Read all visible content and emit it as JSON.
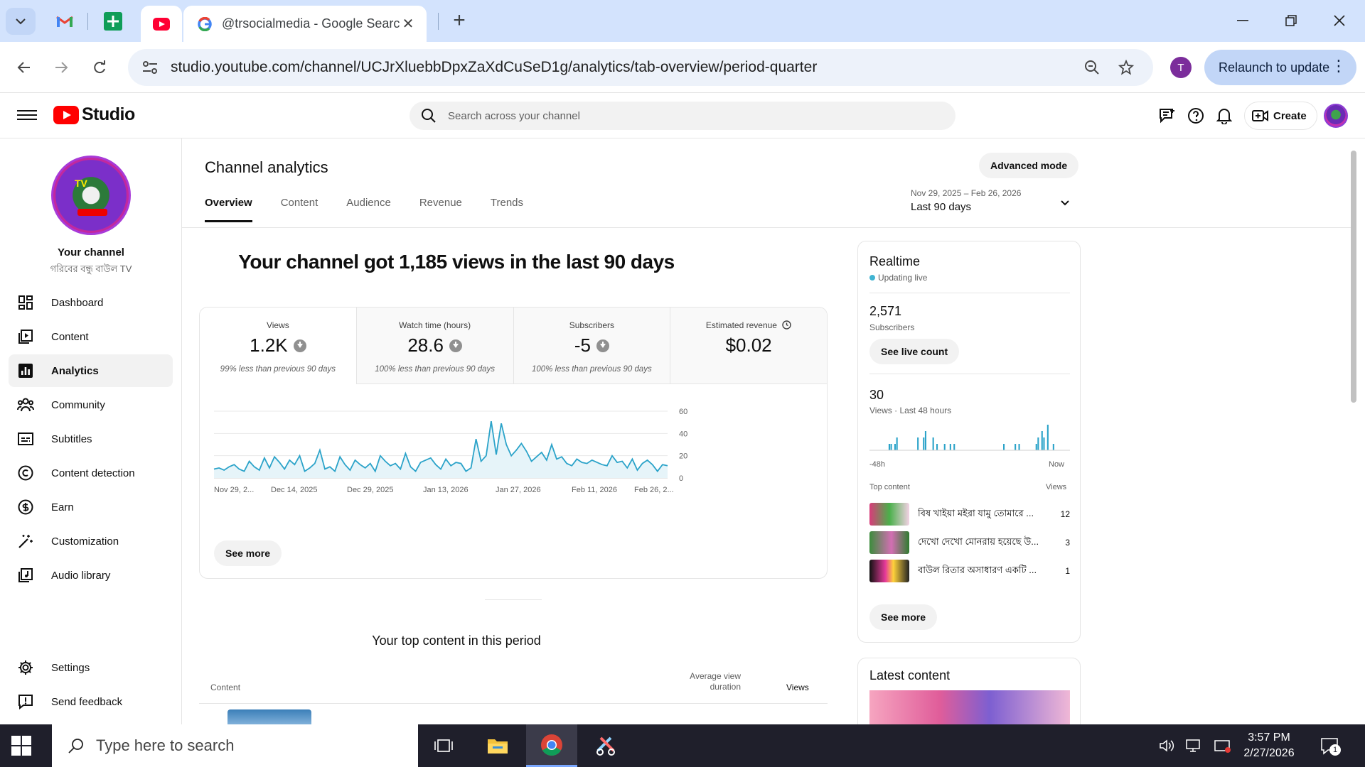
{
  "browser": {
    "active_tab_title": "@trsocialmedia - Google Search",
    "url": "studio.youtube.com/channel/UCJrXluebbDpxZaXdCuSeD1g/analytics/tab-overview/period-quarter",
    "profile_initial": "T",
    "relaunch_label": "Relaunch to update"
  },
  "studio": {
    "logo_text": "Studio",
    "search_placeholder": "Search across your channel",
    "create_label": "Create"
  },
  "sidebar": {
    "channel_label": "Your channel",
    "channel_name": "গরিবের বন্ধু বাউল TV",
    "avatar_text": "TV",
    "items": [
      {
        "label": "Dashboard",
        "icon": "dashboard-icon"
      },
      {
        "label": "Content",
        "icon": "content-icon"
      },
      {
        "label": "Analytics",
        "icon": "analytics-icon",
        "active": true
      },
      {
        "label": "Community",
        "icon": "community-icon"
      },
      {
        "label": "Subtitles",
        "icon": "subtitles-icon"
      },
      {
        "label": "Content detection",
        "icon": "copyright-icon"
      },
      {
        "label": "Earn",
        "icon": "dollar-icon"
      },
      {
        "label": "Customization",
        "icon": "magic-wand-icon"
      },
      {
        "label": "Audio library",
        "icon": "audio-library-icon"
      }
    ],
    "bottom_items": [
      {
        "label": "Settings",
        "icon": "gear-icon"
      },
      {
        "label": "Send feedback",
        "icon": "feedback-icon"
      }
    ]
  },
  "analytics": {
    "title": "Channel analytics",
    "advanced_mode_label": "Advanced mode",
    "tabs": [
      "Overview",
      "Content",
      "Audience",
      "Revenue",
      "Trends"
    ],
    "period_range": "Nov 29, 2025 – Feb 26, 2026",
    "period_label": "Last 90 days",
    "headline": "Your channel got 1,185 views in the last 90 days",
    "metrics": [
      {
        "label": "Views",
        "value": "1.2K",
        "note": "99% less than previous 90 days"
      },
      {
        "label": "Watch time (hours)",
        "value": "28.6",
        "note": "100% less than previous 90 days"
      },
      {
        "label": "Subscribers",
        "value": "-5",
        "note": "100% less than previous 90 days"
      },
      {
        "label": "Estimated revenue",
        "value": "$0.02",
        "note": ""
      }
    ],
    "see_more_label": "See more",
    "top_content_title": "Your top content in this period",
    "top_content_columns": {
      "content": "Content",
      "avg": "Average view duration",
      "views": "Views"
    }
  },
  "chart_data": {
    "type": "line",
    "title": "",
    "xlabel": "",
    "ylabel": "",
    "ylim": [
      0,
      60
    ],
    "yticks": [
      0,
      20,
      40,
      60
    ],
    "x_tick_labels": [
      "Nov 29, 2...",
      "Dec 14, 2025",
      "Dec 29, 2025",
      "Jan 13, 2026",
      "Jan 27, 2026",
      "Feb 11, 2026",
      "Feb 26, 2..."
    ],
    "series": [
      {
        "name": "",
        "values": [
          8,
          9,
          7,
          10,
          12,
          8,
          6,
          15,
          10,
          7,
          18,
          9,
          19,
          14,
          8,
          16,
          12,
          20,
          6,
          9,
          13,
          25,
          8,
          10,
          6,
          19,
          12,
          7,
          16,
          12,
          9,
          13,
          6,
          20,
          15,
          11,
          13,
          8,
          22,
          10,
          6,
          14,
          16,
          18,
          12,
          8,
          17,
          11,
          14,
          13,
          6,
          9,
          35,
          15,
          20,
          51,
          21,
          49,
          30,
          20,
          25,
          31,
          24,
          15,
          19,
          23,
          16,
          30,
          17,
          19,
          13,
          11,
          17,
          14,
          13,
          16,
          14,
          12,
          11,
          20,
          14,
          15,
          9,
          17,
          7,
          13,
          16,
          12,
          6,
          12,
          11
        ]
      }
    ],
    "color": "#2ba3c9"
  },
  "realtime": {
    "title": "Realtime",
    "live_label": "Updating live",
    "subscribers_value": "2,571",
    "subscribers_label": "Subscribers",
    "see_live_label": "See live count",
    "views_value": "30",
    "views_label": "Views · Last 48 hours",
    "axis_left": "-48h",
    "axis_right": "Now",
    "bars": [
      0,
      0,
      0,
      0,
      0,
      0,
      0,
      0,
      0,
      0,
      1,
      1,
      0,
      1,
      2,
      0,
      0,
      0,
      0,
      0,
      0,
      0,
      0,
      0,
      0,
      2,
      0,
      0,
      2,
      3,
      0,
      0,
      0,
      2,
      0,
      1,
      0,
      0,
      0,
      1,
      0,
      0,
      1,
      0,
      1,
      0,
      0,
      0,
      0,
      0,
      0,
      0,
      0,
      0,
      0,
      0,
      0,
      0,
      0,
      0,
      0,
      0,
      0,
      0,
      0,
      0,
      0,
      0,
      0,
      0,
      1,
      0,
      0,
      0,
      0,
      0,
      1,
      0,
      1,
      0,
      0,
      0,
      0,
      0,
      0,
      0,
      0,
      1,
      2,
      0,
      3,
      2,
      0,
      4,
      0,
      0,
      1,
      0,
      0,
      0,
      0,
      0,
      0,
      0,
      0
    ],
    "top_content_label": "Top content",
    "views_col_label": "Views",
    "items": [
      {
        "title": "বিষ খাইয়া মইরা যামু তোমারে ...",
        "views": "12"
      },
      {
        "title": "দেখো দেখো মোনরায় হয়েছে উ...",
        "views": "3"
      },
      {
        "title": "বাউল রিতার অসাধারণ একটি ...",
        "views": "1"
      }
    ],
    "see_more_label": "See more"
  },
  "latest": {
    "title": "Latest content"
  },
  "taskbar": {
    "search_placeholder": "Type here to search",
    "time": "3:57 PM",
    "date": "2/27/2026",
    "notification_count": "1"
  }
}
